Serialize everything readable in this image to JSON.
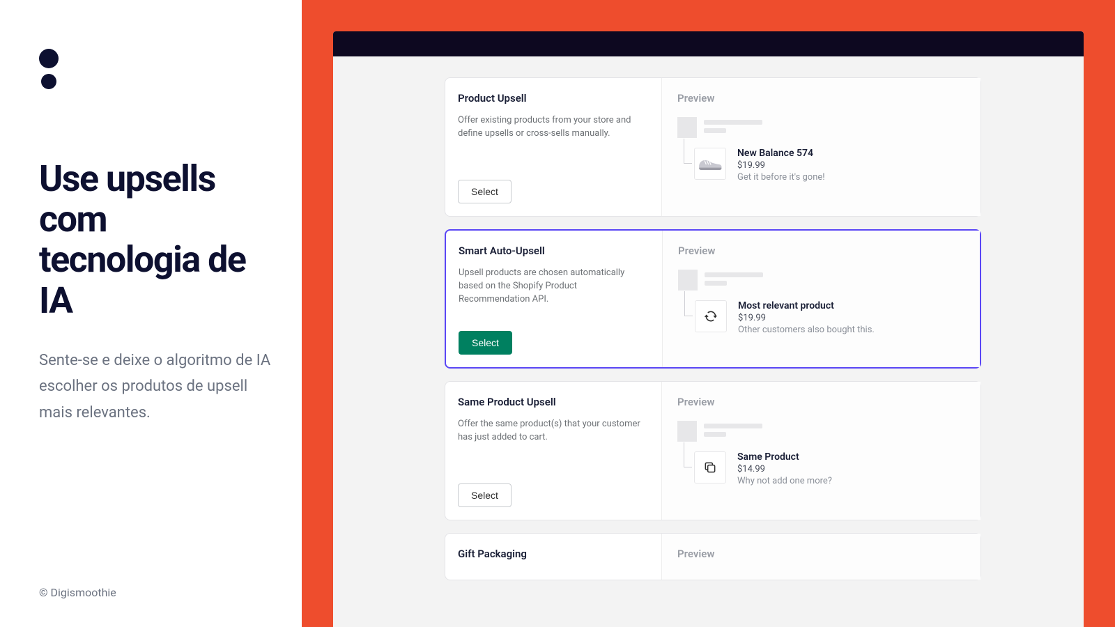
{
  "left": {
    "headline": "Use upsells com tecnologia de IA",
    "subtext": "Sente-se e deixe o algoritmo de IA escolher os produtos de upsell mais relevantes.",
    "copyright": "© Digismoothie"
  },
  "cards": [
    {
      "title": "Product Upsell",
      "desc": "Offer existing products from your store and define upsells or cross-sells manually.",
      "select_label": "Select",
      "preview_label": "Preview",
      "product": {
        "name": "New Balance 574",
        "price": "$19.99",
        "tagline": "Get it before it's gone!"
      }
    },
    {
      "title": "Smart Auto-Upsell",
      "desc": "Upsell products are chosen automatically based on the Shopify Product Recommendation API.",
      "select_label": "Select",
      "preview_label": "Preview",
      "product": {
        "name": "Most relevant product",
        "price": "$19.99",
        "tagline": "Other customers also bought this."
      }
    },
    {
      "title": "Same Product Upsell",
      "desc": "Offer the same product(s) that your customer has just added to cart.",
      "select_label": "Select",
      "preview_label": "Preview",
      "product": {
        "name": "Same Product",
        "price": "$14.99",
        "tagline": "Why not add one more?"
      }
    },
    {
      "title": "Gift Packaging",
      "preview_label": "Preview"
    }
  ]
}
